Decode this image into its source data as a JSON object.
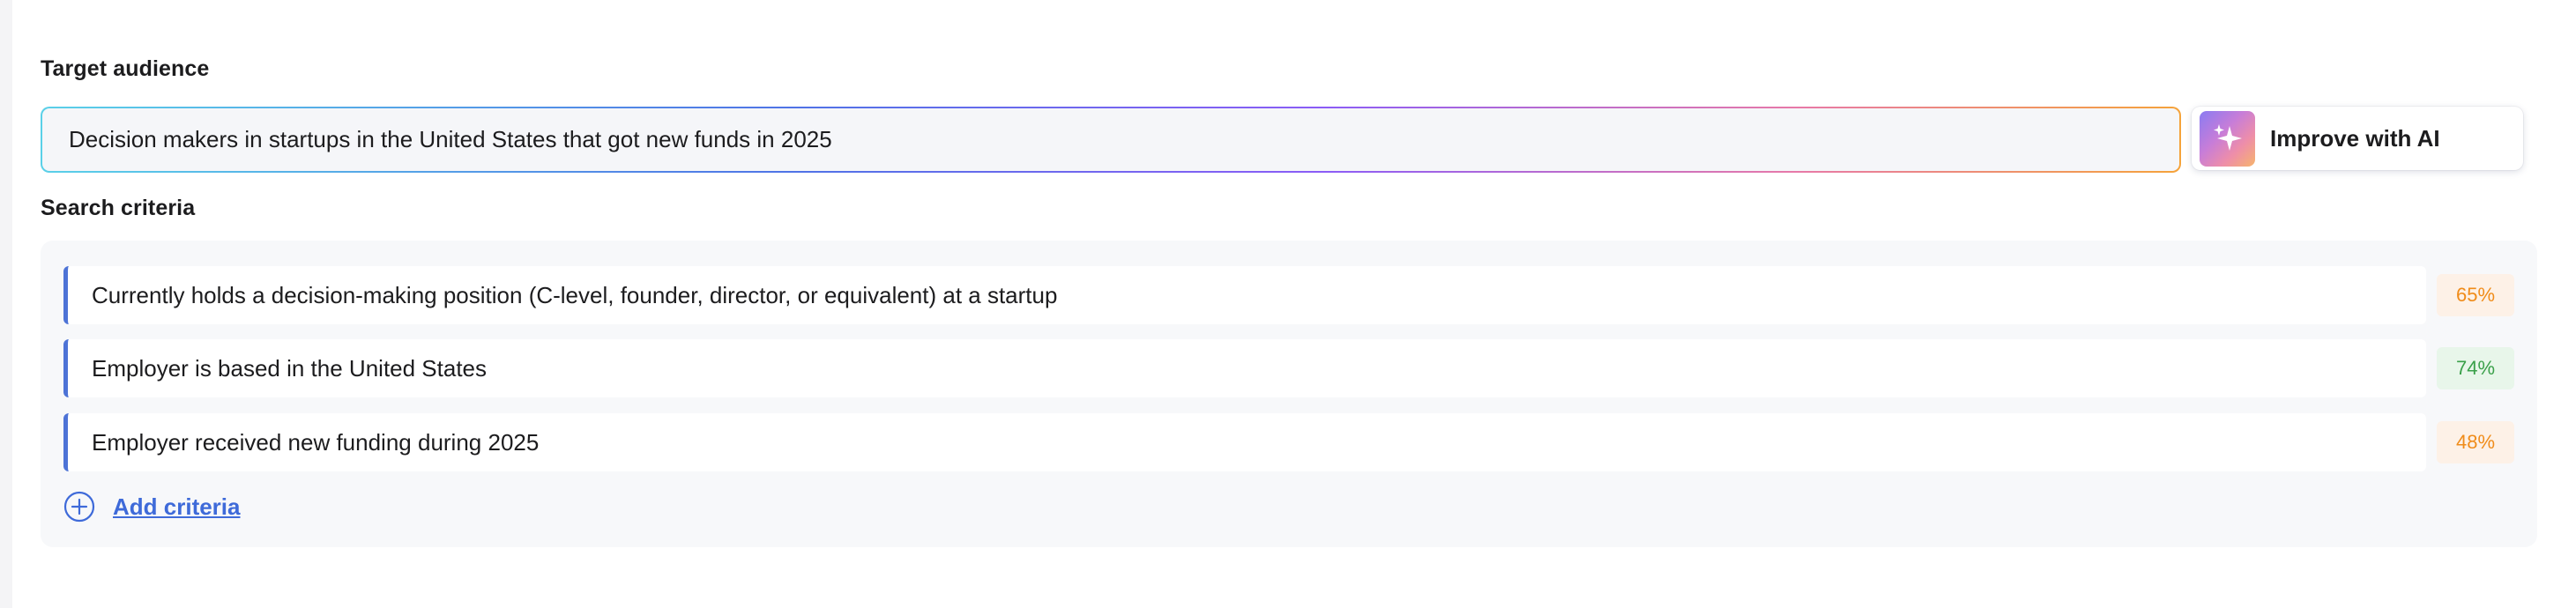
{
  "target_audience": {
    "label": "Target audience",
    "value": "Decision makers in startups in the United States that got new funds in 2025"
  },
  "improve_button": {
    "label": "Improve with AI",
    "icon": "sparkles-icon"
  },
  "search_criteria": {
    "label": "Search criteria",
    "items": [
      {
        "text": "Currently holds a decision-making position (C-level, founder, director, or equivalent) at a startup",
        "score": "65%",
        "score_color": "#f08c1a"
      },
      {
        "text": "Employer is based in the United States",
        "score": "74%",
        "score_color": "#3aa04a"
      },
      {
        "text": "Employer received new funding during 2025",
        "score": "48%",
        "score_color": "#f08c1a"
      }
    ],
    "add_label": "Add criteria",
    "add_icon": "plus-circle-icon"
  },
  "colors": {
    "accent": "#4d73d6",
    "link": "#3e6ad9"
  }
}
